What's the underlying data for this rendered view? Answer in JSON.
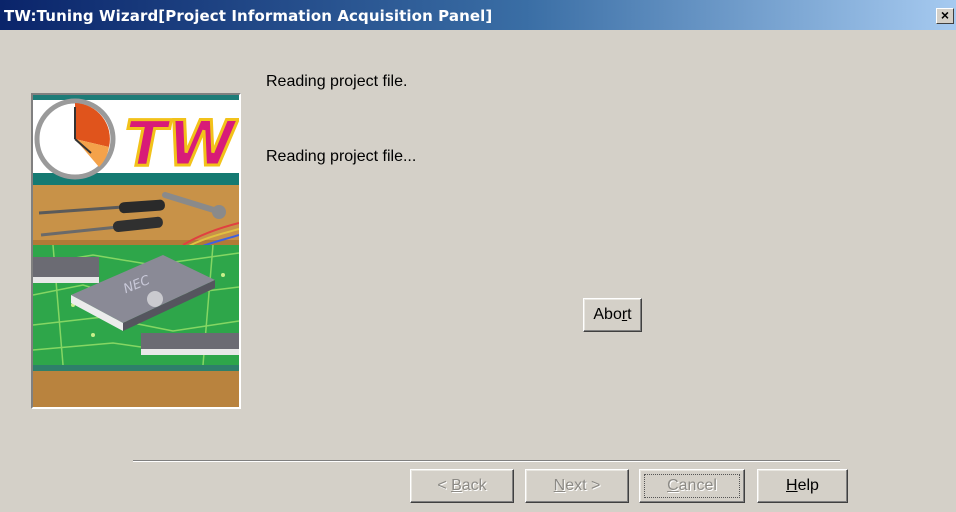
{
  "window": {
    "title": "TW:Tuning Wizard[Project Information Acquisition Panel]",
    "close_label": "×"
  },
  "art": {
    "logo_text": "TW",
    "chip_label": "NEC"
  },
  "status": {
    "heading": "Reading project file.",
    "detail": "Reading project file..."
  },
  "buttons": {
    "abort": {
      "label": "Abort",
      "mnemonic": "r"
    },
    "back": {
      "label": "< Back",
      "mnemonic": "B",
      "enabled": false
    },
    "next": {
      "label": "Next >",
      "mnemonic": "N",
      "enabled": false
    },
    "cancel": {
      "label": "Cancel",
      "mnemonic": "C",
      "enabled": false
    },
    "help": {
      "label": "Help",
      "mnemonic": "H",
      "enabled": true
    }
  }
}
